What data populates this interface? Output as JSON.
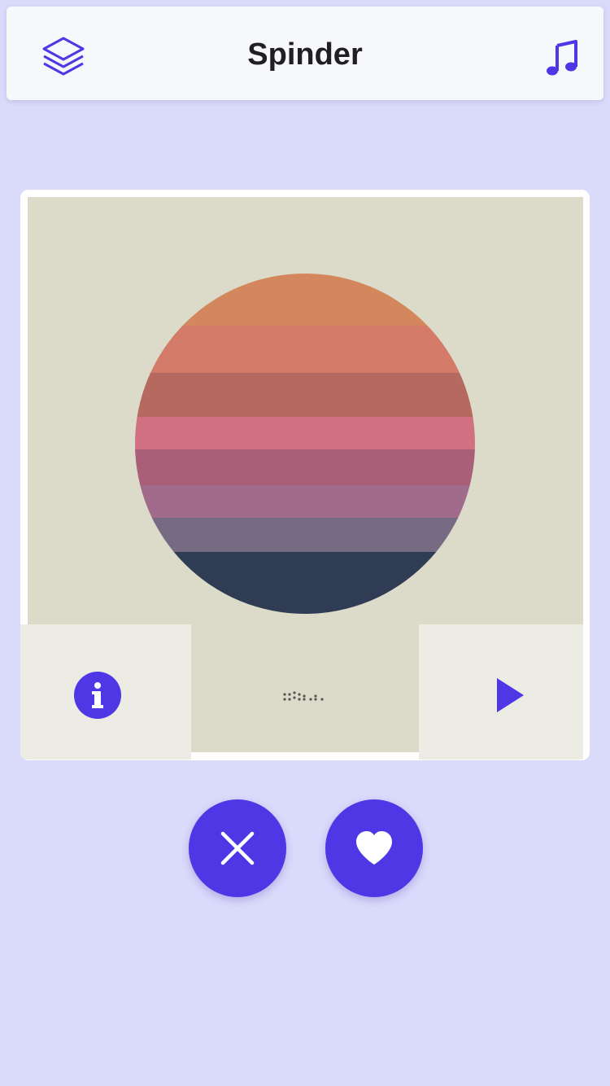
{
  "app": {
    "title": "Spinder"
  },
  "header": {
    "left_icon": "layers-icon",
    "right_icon": "music-note-icon"
  },
  "card": {
    "artwork_icon": "sunset-album-art",
    "info_icon": "info-icon",
    "play_icon": "play-icon",
    "pager_icon": "dots-indicator"
  },
  "actions": {
    "reject_icon": "close-icon",
    "like_icon": "heart-icon"
  },
  "colors": {
    "accent": "#4f37e6",
    "background": "#dadafb",
    "header_bg": "#f7f8fb",
    "artwork_bg": "#dcdac9",
    "panel_bg": "#edece4",
    "sun_stripes": [
      "#d4875d",
      "#d47a68",
      "#b6695e",
      "#d27083",
      "#aa5f78",
      "#a16b8b",
      "#756c84",
      "#303c53"
    ]
  }
}
